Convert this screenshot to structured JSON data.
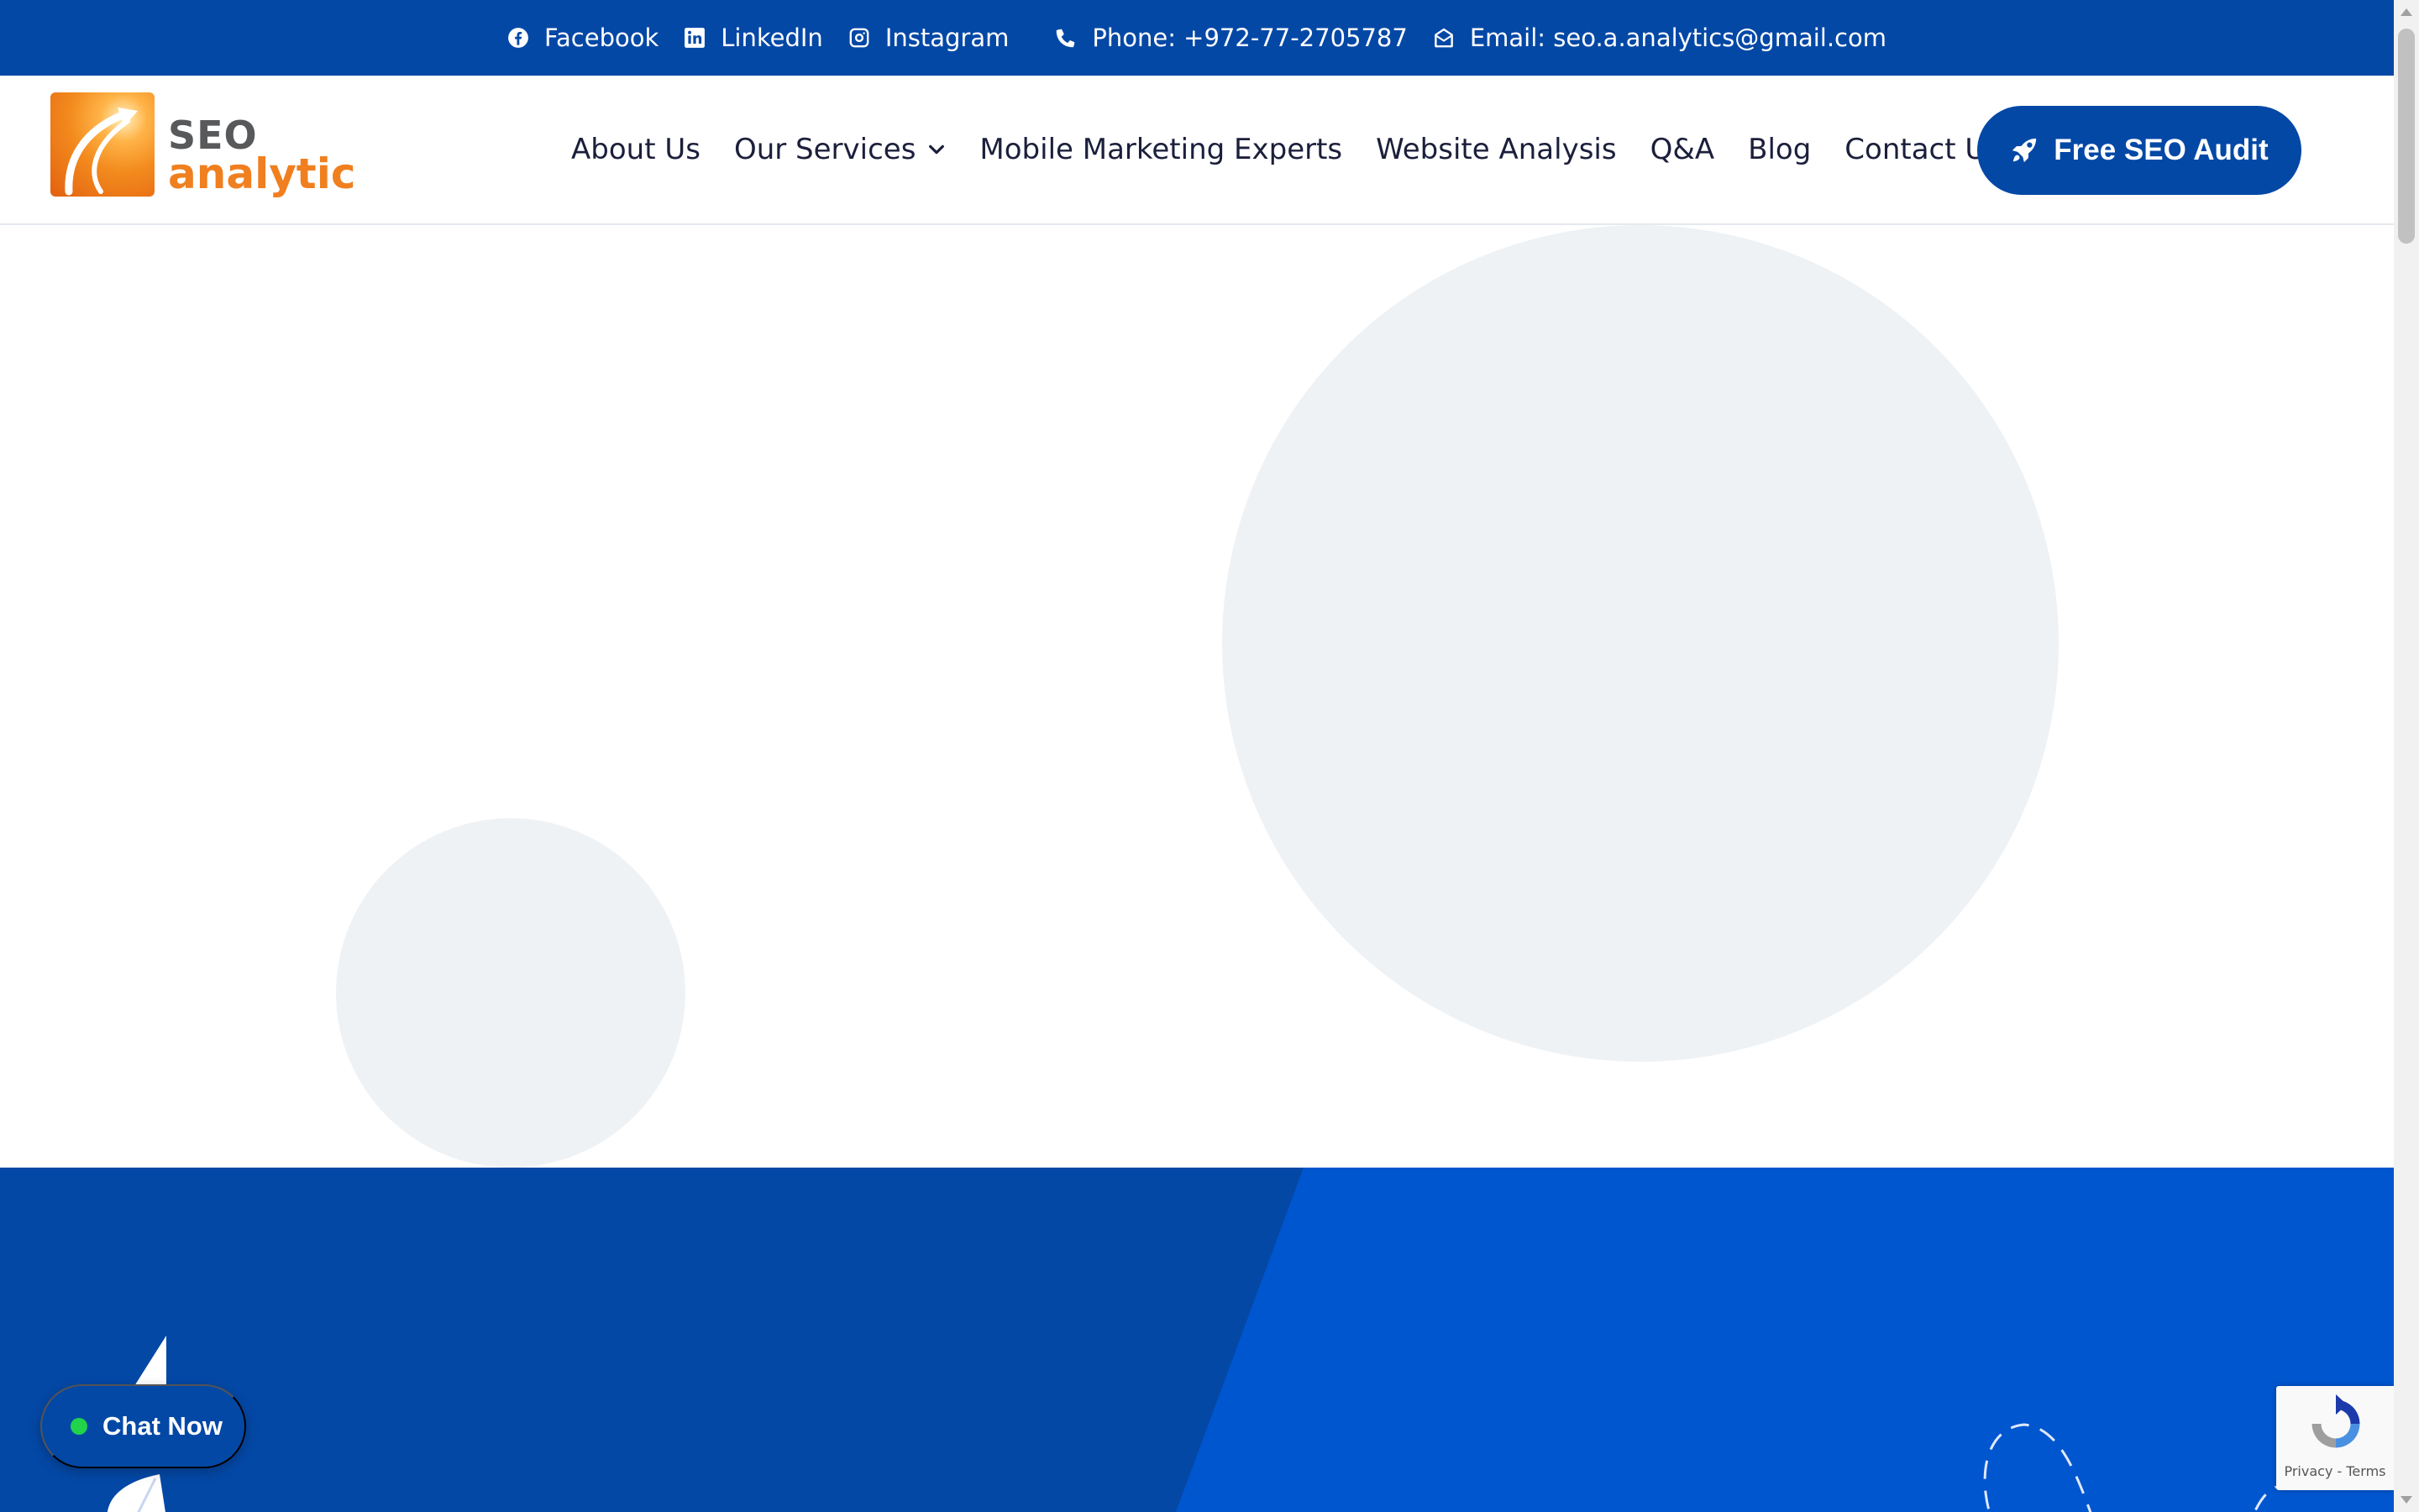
{
  "topbar": {
    "facebook": "Facebook",
    "linkedin": "LinkedIn",
    "instagram": "Instagram",
    "phone": "Phone: +972-77-2705787",
    "email": "Email: seo.a.analytics@gmail.com"
  },
  "logo": {
    "line1": "SEO",
    "line2": "analytic"
  },
  "nav": {
    "items": [
      "About Us",
      "Our Services",
      "Mobile Marketing Experts",
      "Website Analysis",
      "Q&A",
      "Blog",
      "Contact Us"
    ]
  },
  "cta": {
    "label": "Free SEO Audit"
  },
  "chat": {
    "label": "Chat Now"
  },
  "recaptcha": {
    "privacy": "Privacy",
    "separator": " - ",
    "terms": "Terms"
  },
  "colors": {
    "primary_blue": "#0448a6",
    "bright_blue": "#0056cf",
    "logo_orange": "#f07f1f",
    "logo_gray": "#58595b",
    "circle_gray": "#eff2f5",
    "chat_green": "#21d34a"
  },
  "icons": {
    "facebook": "facebook-icon",
    "linkedin": "linkedin-icon",
    "instagram": "instagram-icon",
    "phone": "phone-icon",
    "email": "envelope-open-icon",
    "chevron": "chevron-down-icon",
    "rocket": "rocket-icon",
    "recaptcha": "recaptcha-icon"
  }
}
